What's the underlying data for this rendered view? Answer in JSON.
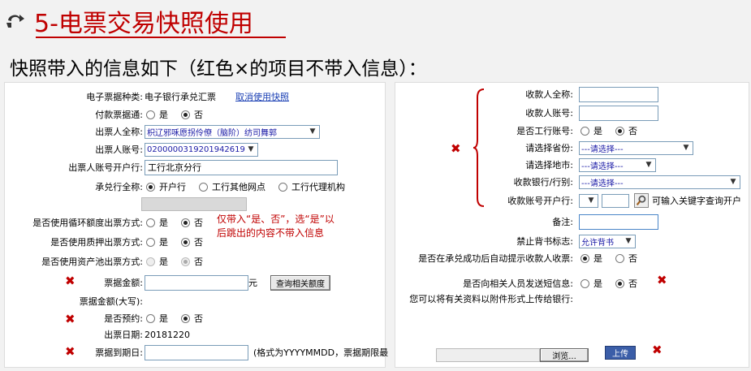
{
  "header": {
    "title": "5-电票交易快照使用",
    "subtitle": "快照带入的信息如下（红色×的项目不带入信息）："
  },
  "left": {
    "bill_type": {
      "label": "电子票据种类:",
      "value": "电子银行承兑汇票",
      "link": "取消使用快照"
    },
    "pay_bill": {
      "label": "付款票据通:",
      "yes": "是",
      "no": "否"
    },
    "drawer_name": {
      "label": "出票人全称:",
      "value": "枳辽邪咊愿拐伶僚（脑阶）纺司舞郭"
    },
    "drawer_acct": {
      "label": "出票人账号:",
      "value": "0200000319201942619"
    },
    "drawer_bank": {
      "label": "出票人账号开户行:",
      "value": "工行北京分行"
    },
    "acceptor": {
      "label": "承兑行全称:",
      "opt1": "开户行",
      "opt2": "工行其他网点",
      "opt3": "工行代理机构"
    },
    "revolving": {
      "label": "是否使用循环额度出票方式:",
      "yes": "是",
      "no": "否"
    },
    "pledge": {
      "label": "是否使用质押出票方式:",
      "yes": "是",
      "no": "否"
    },
    "asset_pool": {
      "label": "是否使用资产池出票方式:",
      "yes": "是",
      "no": "否"
    },
    "note": [
      "仅带入“是、否”，选“是”以",
      "后跳出的内容不带入信息"
    ],
    "amount": {
      "label": "票据金额:",
      "unit": "元",
      "button": "查询相关额度"
    },
    "amount_upper": {
      "label": "票据金额(大写):"
    },
    "reserve": {
      "label": "是否预约:",
      "yes": "是",
      "no": "否"
    },
    "issue_date": {
      "label": "出票日期:",
      "value": "20181220"
    },
    "due_date": {
      "label": "票据到期日:",
      "hint": "(格式为YYYYMMDD，票据期限最"
    }
  },
  "right": {
    "payee_name": {
      "label": "收款人全称:"
    },
    "payee_acct": {
      "label": "收款人账号:"
    },
    "icbc_acct": {
      "label": "是否工行账号:",
      "yes": "是",
      "no": "否"
    },
    "province": {
      "label": "请选择省份:",
      "value": "---请选择---"
    },
    "city": {
      "label": "请选择地市:",
      "value": "---请选择---"
    },
    "recv_bank": {
      "label": "收款银行/行别:",
      "value": "---请选择---"
    },
    "recv_branch": {
      "label": "收款账号开户行:",
      "hint": "可输入关键字查询开户"
    },
    "remark": {
      "label": "备注:"
    },
    "endorse": {
      "label": "禁止背书标志:",
      "value": "允许背书"
    },
    "auto_prompt": {
      "label": "是否在承兑成功后自动提示收款人收票:",
      "yes": "是",
      "no": "否"
    },
    "sms": {
      "label": "是否向相关人员发送短信息:",
      "yes": "是",
      "no": "否"
    },
    "attach": {
      "label": "您可以将有关资料以附件形式上传给银行:",
      "browse": "浏览...",
      "upload": "上传"
    }
  },
  "marks": {
    "x": "✖"
  }
}
